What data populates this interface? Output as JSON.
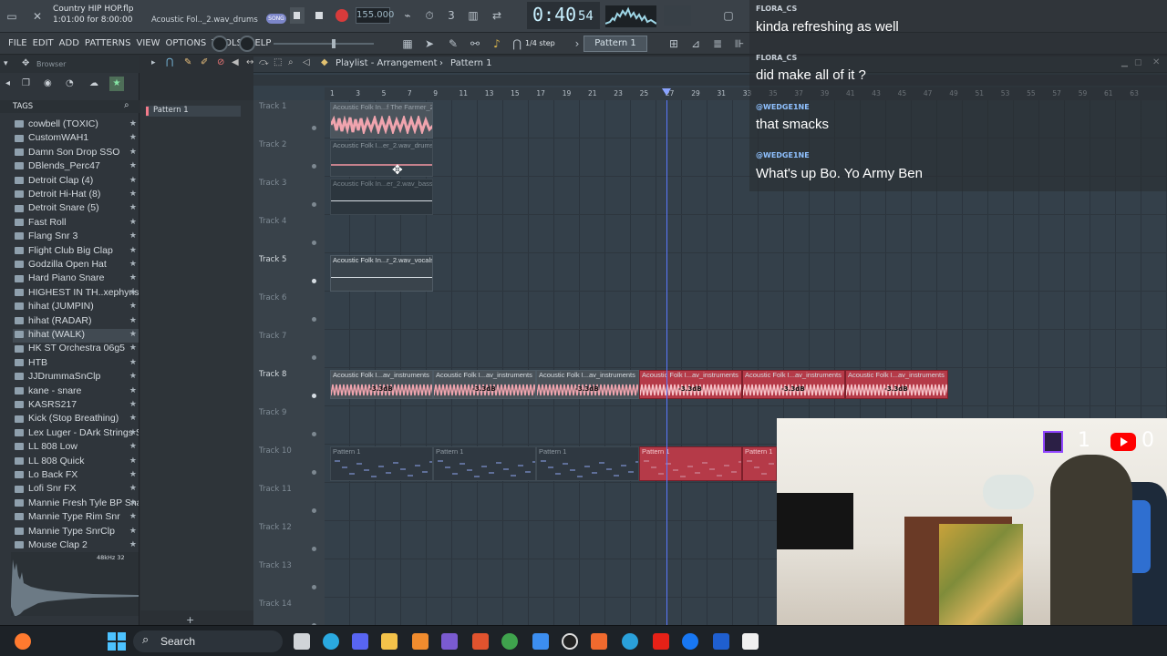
{
  "topbar": {
    "song_title": "Country HIP HOP.flp",
    "song_time": "1:01:00 for 8:00:00",
    "file_hint": "Acoustic Fol.._2.wav_drums",
    "song_mode": "SONG",
    "tempo": "155.000",
    "clock": "0:40",
    "clock_frac": "54",
    "step_label": "1/4 step",
    "pattern_selector": "Pattern 1"
  },
  "menubar": {
    "items": [
      "FILE",
      "EDIT",
      "ADD",
      "PATTERNS",
      "VIEW",
      "OPTIONS",
      "TOOLS",
      "HELP"
    ]
  },
  "browser": {
    "title": "Browser",
    "tags_label": "TAGS",
    "items": [
      "cowbell (TOXIC)",
      "CustomWAH1",
      "Damn Son Drop SSO",
      "DBlends_Perc47",
      "Detroit Clap (4)",
      "Detroit Hi-Hat (8)",
      "Detroit Snare (5)",
      "Fast Roll",
      "Flang Snr 3",
      "Flight Club Big Clap",
      "Godzilla Open Hat",
      "Hard Piano Snare",
      "HIGHEST IN TH..xephyrisdead)",
      "hihat (JUMPIN)",
      "hihat (RADAR)",
      "hihat (WALK)",
      "HK ST Orchestra 06g5",
      "HTB",
      "JJDrummaSnClp",
      "kane - snare",
      "KASRS217",
      "Kick (Stop Breathing)",
      "Lex Luger - DArk Strings STC",
      "LL 808 Low",
      "LL 808 Quick",
      "Lo Back FX",
      "Lofi Snr FX",
      "Mannie Fresh Tyle BP Snare",
      "Mannie Type Rim Snr",
      "Mannie Type SnrClp",
      "Mouse Clap 2"
    ],
    "sample_info": "48kHz 32"
  },
  "patterns": {
    "pattern_label": "Pattern 1"
  },
  "playlist": {
    "title": "Playlist - Arrangement",
    "pattern": "Pattern 1",
    "ruler": [
      "1",
      "3",
      "5",
      "7",
      "9",
      "11",
      "13",
      "15",
      "17",
      "19",
      "21",
      "23",
      "25",
      "27",
      "29",
      "31",
      "33",
      "35",
      "37",
      "39",
      "41",
      "43",
      "45",
      "47",
      "49",
      "51",
      "53",
      "55",
      "57",
      "59",
      "61",
      "63"
    ],
    "tracks": [
      "Track 1",
      "Track 2",
      "Track 3",
      "Track 4",
      "Track 5",
      "Track 6",
      "Track 7",
      "Track 8",
      "Track 9",
      "Track 10",
      "Track 11",
      "Track 12",
      "Track 13",
      "Track 14"
    ],
    "clips": {
      "t1": "Acoustic Folk In...f The Farmer_2",
      "t2": "Acoustic Folk I...er_2.wav_drums",
      "t3": "Acoustic Folk In...er_2.wav_bass",
      "t5": "Acoustic Folk In...r_2.wav_vocals",
      "t8": "Acoustic Folk I...av_instruments",
      "t8_db": "-3.3dB",
      "t10": "Pattern 1"
    }
  },
  "chat": {
    "messages": [
      {
        "user": "FLORA_CS",
        "text": "kinda refreshing as well"
      },
      {
        "user": "FLORA_CS",
        "text": "did make all of it ?"
      },
      {
        "user": "@WEDGE1NE",
        "text": "that smacks"
      },
      {
        "user": "@WEDGE1NE",
        "text": "What's up Bo. Yo Army Ben"
      }
    ]
  },
  "webcam": {
    "twitch_count": "1",
    "youtube_count": "0"
  },
  "taskbar": {
    "search_label": "Search"
  },
  "colors": {
    "accent": "#f5a0a8",
    "red_clip": "#b53a48",
    "twitch": "#9146ff",
    "youtube": "#ff0000"
  }
}
